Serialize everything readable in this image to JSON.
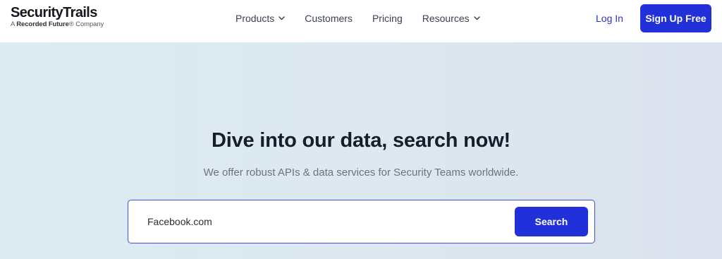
{
  "brand": {
    "name": "SecurityTrails",
    "tagline_prefix": "A ",
    "tagline_brand": "Recorded Future",
    "tagline_suffix": "® Company"
  },
  "nav": {
    "items": [
      {
        "label": "Products",
        "has_dropdown": true
      },
      {
        "label": "Customers",
        "has_dropdown": false
      },
      {
        "label": "Pricing",
        "has_dropdown": false
      },
      {
        "label": "Resources",
        "has_dropdown": true
      }
    ],
    "login_label": "Log In",
    "signup_label": "Sign Up Free"
  },
  "hero": {
    "title": "Dive into our data, search now!",
    "subtitle": "We offer robust APIs & data services for Security Teams worldwide."
  },
  "search": {
    "value": "Facebook.com",
    "button_label": "Search"
  },
  "colors": {
    "accent": "#2130d8",
    "link": "#2737c9",
    "hero_bg": "#dde8ef"
  },
  "icons": {
    "dropdown": "chevron-down-icon"
  }
}
